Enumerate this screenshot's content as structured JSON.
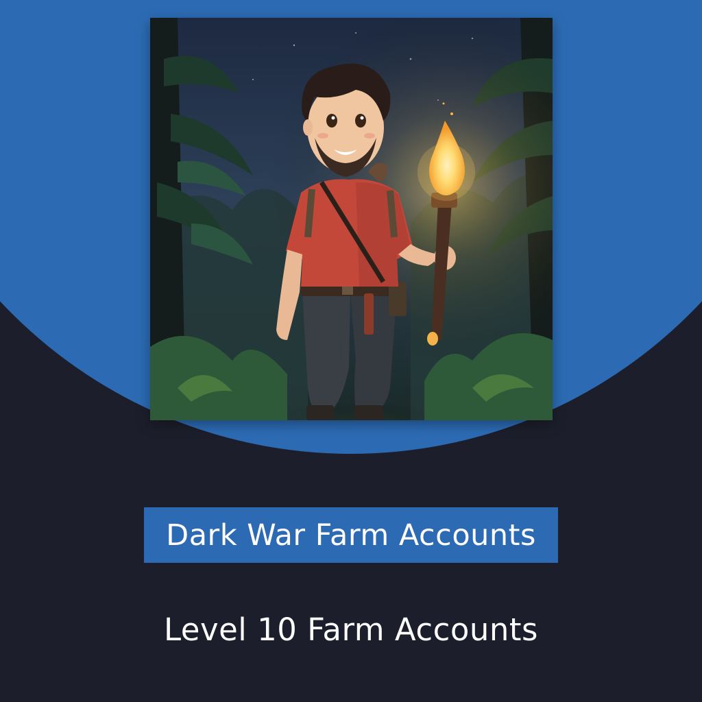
{
  "colors": {
    "background": "#1c1f2b",
    "accent_blue": "#2c6bb4",
    "text": "#ffffff"
  },
  "artwork": {
    "subject": "cartoon-explorer-with-torch-in-jungle-at-night"
  },
  "title": {
    "text": "Dark War Farm Accounts"
  },
  "subtitle": {
    "text": "Level 10 Farm Accounts"
  }
}
